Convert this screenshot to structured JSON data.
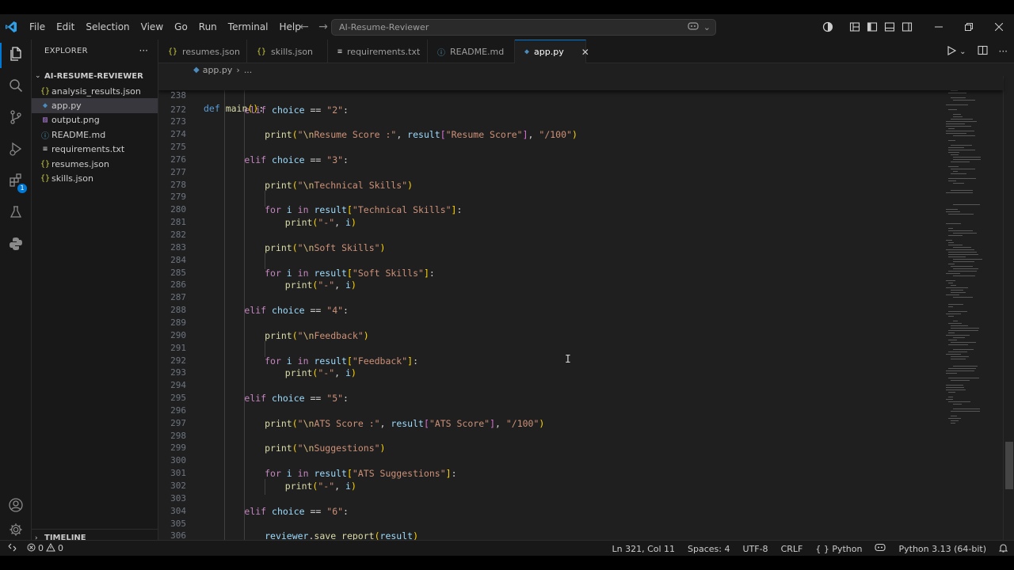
{
  "menu": [
    "File",
    "Edit",
    "Selection",
    "View",
    "Go",
    "Run",
    "Terminal",
    "Help"
  ],
  "command_center": {
    "text": "AI-Resume-Reviewer"
  },
  "sidebar": {
    "title": "EXPLORER",
    "more": "···",
    "folder": "AI-RESUME-REVIEWER",
    "files": [
      {
        "icon": "{}",
        "icon_color": "#cbcb41",
        "name": "analysis_results.json",
        "active": false
      },
      {
        "icon": "◆",
        "icon_color": "#4b8bbe",
        "name": "app.py",
        "active": true
      },
      {
        "icon": "▨",
        "icon_color": "#a074c4",
        "name": "output.png",
        "active": false
      },
      {
        "icon": "ⓘ",
        "icon_color": "#519aba",
        "name": "README.md",
        "active": false
      },
      {
        "icon": "≡",
        "icon_color": "#cccccc",
        "name": "requirements.txt",
        "active": false
      },
      {
        "icon": "{}",
        "icon_color": "#cbcb41",
        "name": "resumes.json",
        "active": false
      },
      {
        "icon": "{}",
        "icon_color": "#cbcb41",
        "name": "skills.json",
        "active": false
      }
    ],
    "timeline": "TIMELINE"
  },
  "activity_badge": "1",
  "tabs": [
    {
      "icon": "{}",
      "icon_color": "#cbcb41",
      "label": "resumes.json",
      "active": false
    },
    {
      "icon": "{}",
      "icon_color": "#cbcb41",
      "label": "skills.json",
      "active": false
    },
    {
      "icon": "≡",
      "icon_color": "#cccccc",
      "label": "requirements.txt",
      "active": false
    },
    {
      "icon": "ⓘ",
      "icon_color": "#519aba",
      "label": "README.md",
      "active": false
    },
    {
      "icon": "◆",
      "icon_color": "#4b8bbe",
      "label": "app.py",
      "active": true
    }
  ],
  "breadcrumb": {
    "file": "app.py",
    "rest": "..."
  },
  "sticky_line": {
    "number": "238",
    "tokens": [
      [
        "kw2",
        "def "
      ],
      [
        "fn",
        "main"
      ],
      [
        "brk1",
        "()"
      ],
      [
        "op",
        ":"
      ]
    ]
  },
  "code_lines": [
    {
      "n": "272",
      "indent": 2,
      "tokens": [
        [
          "kw",
          "elif "
        ],
        [
          "var",
          "choice"
        ],
        [
          "op",
          " == "
        ],
        [
          "str",
          "\"2\""
        ],
        [
          "op",
          ":"
        ]
      ]
    },
    {
      "n": "273",
      "indent": 0,
      "tokens": []
    },
    {
      "n": "274",
      "indent": 3,
      "tokens": [
        [
          "fn",
          "print"
        ],
        [
          "brk1",
          "("
        ],
        [
          "str",
          "\""
        ],
        [
          "esc",
          "\\n"
        ],
        [
          "str",
          "Resume Score :\""
        ],
        [
          "op",
          ", "
        ],
        [
          "var",
          "result"
        ],
        [
          "brk2",
          "["
        ],
        [
          "str",
          "\"Resume Score\""
        ],
        [
          "brk2",
          "]"
        ],
        [
          "op",
          ", "
        ],
        [
          "str",
          "\"/100\""
        ],
        [
          "brk1",
          ")"
        ]
      ]
    },
    {
      "n": "275",
      "indent": 0,
      "tokens": []
    },
    {
      "n": "276",
      "indent": 2,
      "tokens": [
        [
          "kw",
          "elif "
        ],
        [
          "var",
          "choice"
        ],
        [
          "op",
          " == "
        ],
        [
          "str",
          "\"3\""
        ],
        [
          "op",
          ":"
        ]
      ]
    },
    {
      "n": "277",
      "indent": 0,
      "tokens": []
    },
    {
      "n": "278",
      "indent": 3,
      "tokens": [
        [
          "fn",
          "print"
        ],
        [
          "brk1",
          "("
        ],
        [
          "str",
          "\""
        ],
        [
          "esc",
          "\\n"
        ],
        [
          "str",
          "Technical Skills\""
        ],
        [
          "brk1",
          ")"
        ]
      ]
    },
    {
      "n": "279",
      "indent": 0,
      "tokens": []
    },
    {
      "n": "280",
      "indent": 3,
      "tokens": [
        [
          "kw",
          "for "
        ],
        [
          "var",
          "i"
        ],
        [
          "kw",
          " in "
        ],
        [
          "var",
          "result"
        ],
        [
          "brk1",
          "["
        ],
        [
          "str",
          "\"Technical Skills\""
        ],
        [
          "brk1",
          "]"
        ],
        [
          "op",
          ":"
        ]
      ]
    },
    {
      "n": "281",
      "indent": 4,
      "tokens": [
        [
          "fn",
          "print"
        ],
        [
          "brk1",
          "("
        ],
        [
          "str",
          "\"-\""
        ],
        [
          "op",
          ", "
        ],
        [
          "var",
          "i"
        ],
        [
          "brk1",
          ")"
        ]
      ]
    },
    {
      "n": "282",
      "indent": 0,
      "tokens": []
    },
    {
      "n": "283",
      "indent": 3,
      "tokens": [
        [
          "fn",
          "print"
        ],
        [
          "brk1",
          "("
        ],
        [
          "str",
          "\""
        ],
        [
          "esc",
          "\\n"
        ],
        [
          "str",
          "Soft Skills\""
        ],
        [
          "brk1",
          ")"
        ]
      ]
    },
    {
      "n": "284",
      "indent": 0,
      "tokens": []
    },
    {
      "n": "285",
      "indent": 3,
      "tokens": [
        [
          "kw",
          "for "
        ],
        [
          "var",
          "i"
        ],
        [
          "kw",
          " in "
        ],
        [
          "var",
          "result"
        ],
        [
          "brk1",
          "["
        ],
        [
          "str",
          "\"Soft Skills\""
        ],
        [
          "brk1",
          "]"
        ],
        [
          "op",
          ":"
        ]
      ]
    },
    {
      "n": "286",
      "indent": 4,
      "tokens": [
        [
          "fn",
          "print"
        ],
        [
          "brk1",
          "("
        ],
        [
          "str",
          "\"-\""
        ],
        [
          "op",
          ", "
        ],
        [
          "var",
          "i"
        ],
        [
          "brk1",
          ")"
        ]
      ]
    },
    {
      "n": "287",
      "indent": 0,
      "tokens": []
    },
    {
      "n": "288",
      "indent": 2,
      "tokens": [
        [
          "kw",
          "elif "
        ],
        [
          "var",
          "choice"
        ],
        [
          "op",
          " == "
        ],
        [
          "str",
          "\"4\""
        ],
        [
          "op",
          ":"
        ]
      ]
    },
    {
      "n": "289",
      "indent": 0,
      "tokens": []
    },
    {
      "n": "290",
      "indent": 3,
      "tokens": [
        [
          "fn",
          "print"
        ],
        [
          "brk1",
          "("
        ],
        [
          "str",
          "\""
        ],
        [
          "esc",
          "\\n"
        ],
        [
          "str",
          "Feedback\""
        ],
        [
          "brk1",
          ")"
        ]
      ]
    },
    {
      "n": "291",
      "indent": 0,
      "tokens": []
    },
    {
      "n": "292",
      "indent": 3,
      "tokens": [
        [
          "kw",
          "for "
        ],
        [
          "var",
          "i"
        ],
        [
          "kw",
          " in "
        ],
        [
          "var",
          "result"
        ],
        [
          "brk1",
          "["
        ],
        [
          "str",
          "\"Feedback\""
        ],
        [
          "brk1",
          "]"
        ],
        [
          "op",
          ":"
        ]
      ]
    },
    {
      "n": "293",
      "indent": 4,
      "tokens": [
        [
          "fn",
          "print"
        ],
        [
          "brk1",
          "("
        ],
        [
          "str",
          "\"-\""
        ],
        [
          "op",
          ", "
        ],
        [
          "var",
          "i"
        ],
        [
          "brk1",
          ")"
        ]
      ]
    },
    {
      "n": "294",
      "indent": 0,
      "tokens": []
    },
    {
      "n": "295",
      "indent": 2,
      "tokens": [
        [
          "kw",
          "elif "
        ],
        [
          "var",
          "choice"
        ],
        [
          "op",
          " == "
        ],
        [
          "str",
          "\"5\""
        ],
        [
          "op",
          ":"
        ]
      ]
    },
    {
      "n": "296",
      "indent": 0,
      "tokens": []
    },
    {
      "n": "297",
      "indent": 3,
      "tokens": [
        [
          "fn",
          "print"
        ],
        [
          "brk1",
          "("
        ],
        [
          "str",
          "\""
        ],
        [
          "esc",
          "\\n"
        ],
        [
          "str",
          "ATS Score :\""
        ],
        [
          "op",
          ", "
        ],
        [
          "var",
          "result"
        ],
        [
          "brk2",
          "["
        ],
        [
          "str",
          "\"ATS Score\""
        ],
        [
          "brk2",
          "]"
        ],
        [
          "op",
          ", "
        ],
        [
          "str",
          "\"/100\""
        ],
        [
          "brk1",
          ")"
        ]
      ]
    },
    {
      "n": "298",
      "indent": 0,
      "tokens": []
    },
    {
      "n": "299",
      "indent": 3,
      "tokens": [
        [
          "fn",
          "print"
        ],
        [
          "brk1",
          "("
        ],
        [
          "str",
          "\""
        ],
        [
          "esc",
          "\\n"
        ],
        [
          "str",
          "Suggestions\""
        ],
        [
          "brk1",
          ")"
        ]
      ]
    },
    {
      "n": "300",
      "indent": 0,
      "tokens": []
    },
    {
      "n": "301",
      "indent": 3,
      "tokens": [
        [
          "kw",
          "for "
        ],
        [
          "var",
          "i"
        ],
        [
          "kw",
          " in "
        ],
        [
          "var",
          "result"
        ],
        [
          "brk1",
          "["
        ],
        [
          "str",
          "\"ATS Suggestions\""
        ],
        [
          "brk1",
          "]"
        ],
        [
          "op",
          ":"
        ]
      ]
    },
    {
      "n": "302",
      "indent": 4,
      "tokens": [
        [
          "fn",
          "print"
        ],
        [
          "brk1",
          "("
        ],
        [
          "str",
          "\"-\""
        ],
        [
          "op",
          ", "
        ],
        [
          "var",
          "i"
        ],
        [
          "brk1",
          ")"
        ]
      ]
    },
    {
      "n": "303",
      "indent": 0,
      "tokens": []
    },
    {
      "n": "304",
      "indent": 2,
      "tokens": [
        [
          "kw",
          "elif "
        ],
        [
          "var",
          "choice"
        ],
        [
          "op",
          " == "
        ],
        [
          "str",
          "\"6\""
        ],
        [
          "op",
          ":"
        ]
      ]
    },
    {
      "n": "305",
      "indent": 0,
      "tokens": []
    },
    {
      "n": "306",
      "indent": 3,
      "tokens": [
        [
          "var",
          "reviewer"
        ],
        [
          "op",
          "."
        ],
        [
          "fn",
          "save_report"
        ],
        [
          "brk1",
          "("
        ],
        [
          "var",
          "result"
        ],
        [
          "brk1",
          ")"
        ]
      ]
    },
    {
      "n": "307",
      "indent": 0,
      "tokens": []
    }
  ],
  "status": {
    "errors": "0",
    "warnings": "0",
    "position": "Ln 321, Col 11",
    "spaces": "Spaces: 4",
    "encoding": "UTF-8",
    "eol": "CRLF",
    "language": "Python",
    "interpreter": "Python 3.13 (64-bit)"
  },
  "colors": {
    "accent": "#0078d4",
    "editor_bg": "#1f1f1f",
    "chrome_bg": "#181818",
    "keyword": "#c586c0",
    "string": "#ce9178",
    "function": "#dcdcaa",
    "variable": "#9cdcfe"
  }
}
